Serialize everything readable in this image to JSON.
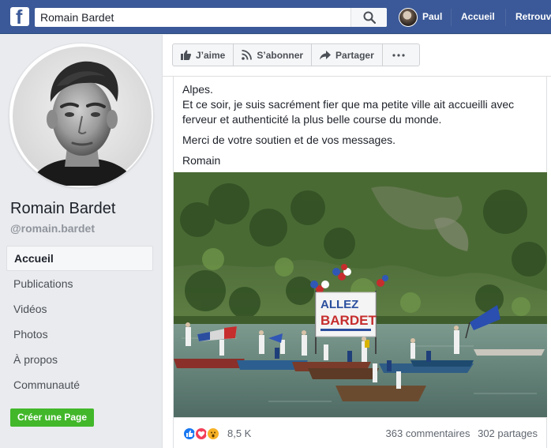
{
  "topbar": {
    "logo": "f",
    "search_value": "Romain Bardet",
    "search_icon": "search-icon",
    "user_name": "Paul",
    "home_label": "Accueil",
    "find_label": "Retrouv"
  },
  "profile": {
    "name": "Romain Bardet",
    "handle": "@romain.bardet"
  },
  "sidebar": {
    "items": [
      {
        "label": "Accueil",
        "active": true
      },
      {
        "label": "Publications"
      },
      {
        "label": "Vidéos"
      },
      {
        "label": "Photos"
      },
      {
        "label": "À propos"
      },
      {
        "label": "Communauté"
      }
    ],
    "create_page_label": "Créer une Page"
  },
  "actions": {
    "like": "J’aime",
    "subscribe": "S’abonner",
    "share": "Partager",
    "more_icon": "more-dots-icon"
  },
  "post": {
    "cut_line": "Alpes.",
    "paragraph_1": "Et ce soir, je suis sacrément fier que ma petite ville ait accueilli avec ferveur et authenticité la plus belle course du monde.",
    "paragraph_2": "Merci de votre soutien et de vos messages.",
    "signature": "Romain",
    "photo": {
      "banner_line_1": "ALLEZ",
      "banner_line_2": "BARDET"
    },
    "reaction_count": "8,5 K",
    "comments": "363 commentaires",
    "shares": "302 partages"
  },
  "colors": {
    "brand": "#3b5998",
    "create_button": "#42b72a",
    "like_blue": "#1877f2",
    "love_red": "#f33e58",
    "haha_yellow": "#f7b125"
  }
}
